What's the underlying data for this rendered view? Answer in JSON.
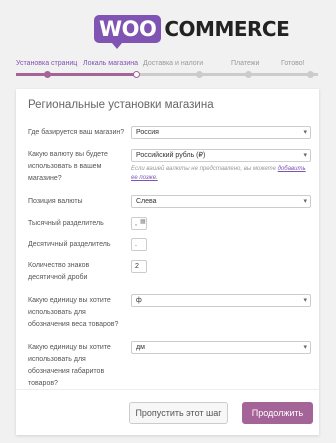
{
  "logo": {
    "woo": "WOO",
    "commerce": "COMMERCE"
  },
  "steps": [
    {
      "label": "Установка страниц",
      "state": "done"
    },
    {
      "label": "Локаль магазина",
      "state": "active"
    },
    {
      "label": "Доставка и налоги",
      "state": "todo"
    },
    {
      "label": "Платежи",
      "state": "todo"
    },
    {
      "label": "Готово!",
      "state": "todo"
    }
  ],
  "card": {
    "title": "Региональные установки магазина",
    "fields": {
      "location": {
        "label": "Где базируется ваш магазин?",
        "value": "Россия"
      },
      "currency": {
        "label": "Какую валюту вы будете использовать в вашем магазине?",
        "value": "Российский рубль (₽)",
        "hint": "Если вашей валюты не представлено, вы можете ",
        "hint_link": "добавить ее позже."
      },
      "currency_pos": {
        "label": "Позиция валюты",
        "value": "Слева"
      },
      "thousand_sep": {
        "label": "Тысячный разделитель",
        "value": ","
      },
      "decimal_sep": {
        "label": "Десятичный разделитель",
        "value": "."
      },
      "decimals": {
        "label": "Количество знаков десятичной дроби",
        "value": "2"
      },
      "weight_unit": {
        "label": "Какую единицу вы хотите использовать для обозначения веса товаров?",
        "value": "ф"
      },
      "dimension_unit": {
        "label": "Какую единицу вы хотите использовать для обозначения габаритов товаров?",
        "value": "дм"
      }
    },
    "buttons": {
      "skip": "Пропустить этот шаг",
      "continue": "Продолжить"
    }
  },
  "colors": {
    "accent": "#a46497",
    "brand": "#7f54b3"
  }
}
